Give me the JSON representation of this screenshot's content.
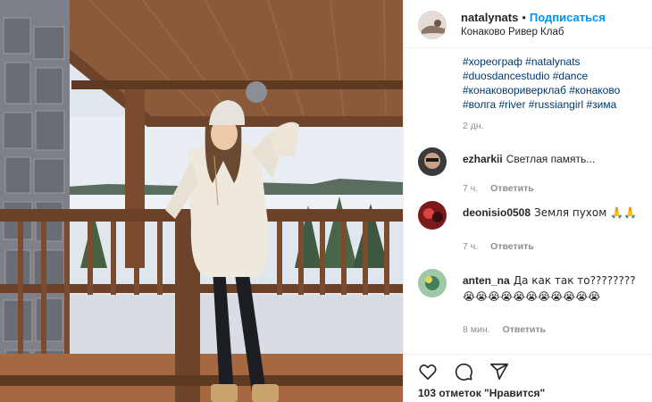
{
  "post": {
    "username": "natalynats",
    "dot": "•",
    "follow_label": "Подписаться",
    "location": "Конаково Ривер Клаб"
  },
  "caption": {
    "lines": [
      "#хореограф #natalynats",
      "#duosdancestudio #dance",
      "#конаковориверклаб #конаково",
      "#волга #river #russiangirl #зима"
    ],
    "time": "2 дн."
  },
  "comments": [
    {
      "user": "ezharkii",
      "text": "Светлая память...",
      "time": "7 ч.",
      "reply": "Ответить"
    },
    {
      "user": "deonisio0508",
      "text": "Земля пухом 🙏🙏",
      "time": "7 ч.",
      "reply": "Ответить"
    },
    {
      "user": "anten_na",
      "text": "Да как так то???????? 😭😭😭😭😭😭😭😭😭😭😭",
      "time": "8 мин.",
      "reply": "Ответить"
    }
  ],
  "footer": {
    "likes": "103 отметок \"Нравится\""
  },
  "icons": [
    "heart-icon",
    "comment-icon",
    "share-icon"
  ],
  "colors": {
    "link": "#00376b",
    "follow": "#0095f6",
    "muted": "#8e8e8e",
    "text": "#262626"
  }
}
